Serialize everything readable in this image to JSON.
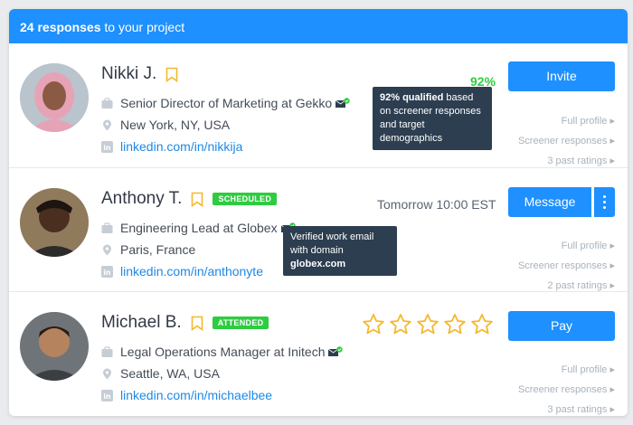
{
  "header": {
    "count": "24 responses",
    "suffix": " to your project"
  },
  "candidates": [
    {
      "name": "Nikki J.",
      "title": "Senior Director of Marketing at Gekko",
      "location": "New York, NY, USA",
      "linkedin": "linkedin.com/in/nikkija",
      "percent": "92%",
      "tooltip_bold": "92% qualified",
      "tooltip_rest": " based on screener responses and target demographics",
      "action": "Invite",
      "links": [
        "Full profile ▸",
        "Screener responses ▸",
        "3 past ratings ▸"
      ]
    },
    {
      "name": "Anthony T.",
      "badge": "SCHEDULED",
      "title": "Engineering Lead at Globex",
      "location": "Paris, France",
      "linkedin": "linkedin.com/in/anthonyte",
      "schedule": "Tomorrow 10:00 EST",
      "tooltip_rest": "Verified work email with domain ",
      "tooltip_bold": "globex.com",
      "action": "Message",
      "links": [
        "Full profile ▸",
        "Screener responses ▸",
        "2 past ratings ▸"
      ]
    },
    {
      "name": "Michael B.",
      "badge": "ATTENDED",
      "title": "Legal Operations Manager at Initech",
      "location": "Seattle, WA, USA",
      "linkedin": "linkedin.com/in/michaelbee",
      "rating_stars": 5,
      "action": "Pay",
      "links": [
        "Full profile ▸",
        "Screener responses ▸",
        "3 past ratings ▸"
      ]
    }
  ],
  "colors": {
    "accent": "#1e90ff",
    "success": "#2ecc40",
    "star": "#f5b82e",
    "tooltip": "#2c3e50"
  }
}
